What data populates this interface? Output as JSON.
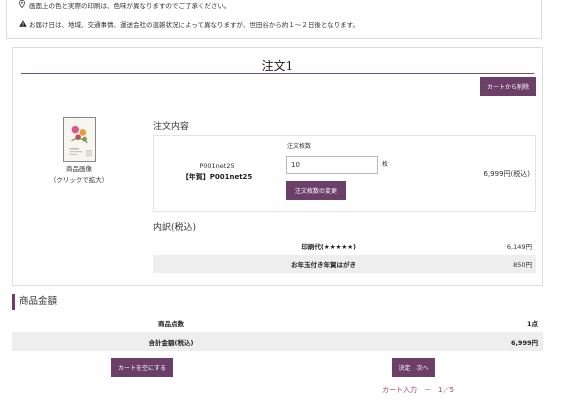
{
  "notices": {
    "line1": "画面上の色と実際の印刷は、色味が異なりますのでご了承ください。",
    "line2": "お届け日は、地域、交通事情、運送会社の混雑状況によって異なりますが、世田谷から約１～２日後となります。",
    "icon1": "map-marker-icon",
    "icon2": "warning-icon"
  },
  "order": {
    "title": "注文1",
    "delete_label": "カートから削除",
    "image_caption_line1": "商品画像",
    "image_caption_line2": "（クリックで拡大）",
    "contents_heading": "注文内容",
    "product_code": "P001net25",
    "product_name": "【年賀】P001net25",
    "quantity_label": "注文枚数",
    "quantity_value": "10",
    "quantity_unit": "枚",
    "change_quantity_label": "注文枚数の変更",
    "price": "6,999円(税込)",
    "breakdown_heading": "内訳(税込)",
    "breakdown": [
      {
        "label": "印刷代(★★★★★)",
        "value": "6,149円"
      },
      {
        "label": "お年玉付き年賀はがき",
        "value": "850円"
      }
    ]
  },
  "summary": {
    "heading": "商品金額",
    "rows": [
      {
        "label": "商品点数",
        "value": "1点"
      },
      {
        "label": "合計金額(税込)",
        "value": "6,999円"
      }
    ]
  },
  "actions": {
    "empty_cart_label": "カートを空にする",
    "decide_label": "決定　次へ",
    "progress_text": "カート入力　－　1／5"
  },
  "colors": {
    "accent": "#6b3f68",
    "progress_text": "#a0405c"
  }
}
